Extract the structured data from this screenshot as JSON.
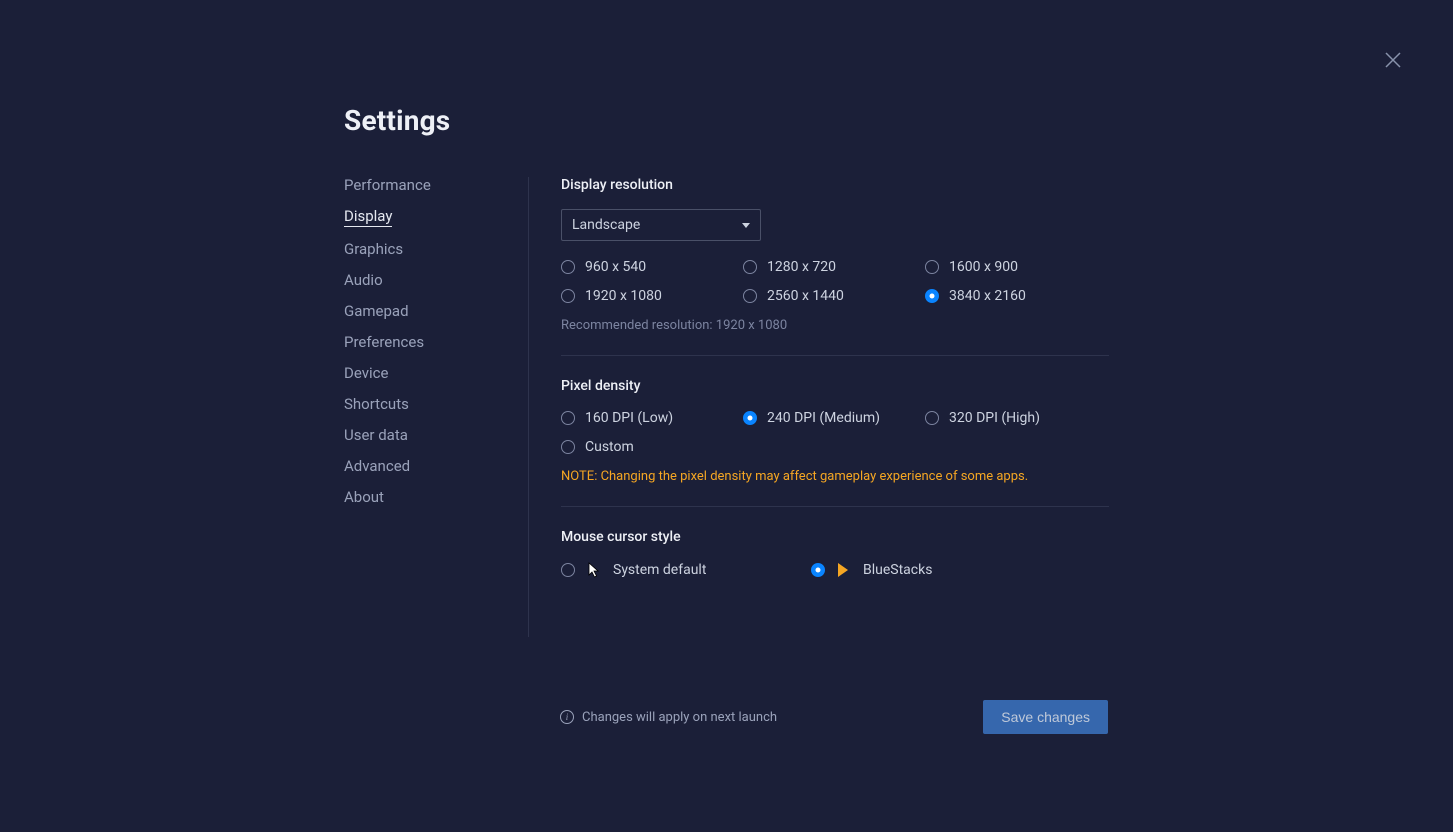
{
  "page_title": "Settings",
  "sidebar": {
    "items": [
      {
        "label": "Performance"
      },
      {
        "label": "Display"
      },
      {
        "label": "Graphics"
      },
      {
        "label": "Audio"
      },
      {
        "label": "Gamepad"
      },
      {
        "label": "Preferences"
      },
      {
        "label": "Device"
      },
      {
        "label": "Shortcuts"
      },
      {
        "label": "User data"
      },
      {
        "label": "Advanced"
      },
      {
        "label": "About"
      }
    ],
    "active_index": 1
  },
  "display_resolution": {
    "title": "Display resolution",
    "orientation_selected": "Landscape",
    "options": [
      "960 x 540",
      "1280 x 720",
      "1600 x 900",
      "1920 x 1080",
      "2560 x 1440",
      "3840 x 2160"
    ],
    "selected_index": 5,
    "recommended_text": "Recommended resolution: 1920 x 1080"
  },
  "pixel_density": {
    "title": "Pixel density",
    "options": [
      "160 DPI (Low)",
      "240 DPI (Medium)",
      "320 DPI (High)",
      "Custom"
    ],
    "selected_index": 1,
    "note": "NOTE: Changing the pixel density may affect gameplay experience of some apps."
  },
  "mouse_cursor": {
    "title": "Mouse cursor style",
    "options": [
      "System default",
      "BlueStacks"
    ],
    "selected_index": 1
  },
  "footer": {
    "info_text": "Changes will apply on next launch",
    "save_label": "Save changes"
  }
}
